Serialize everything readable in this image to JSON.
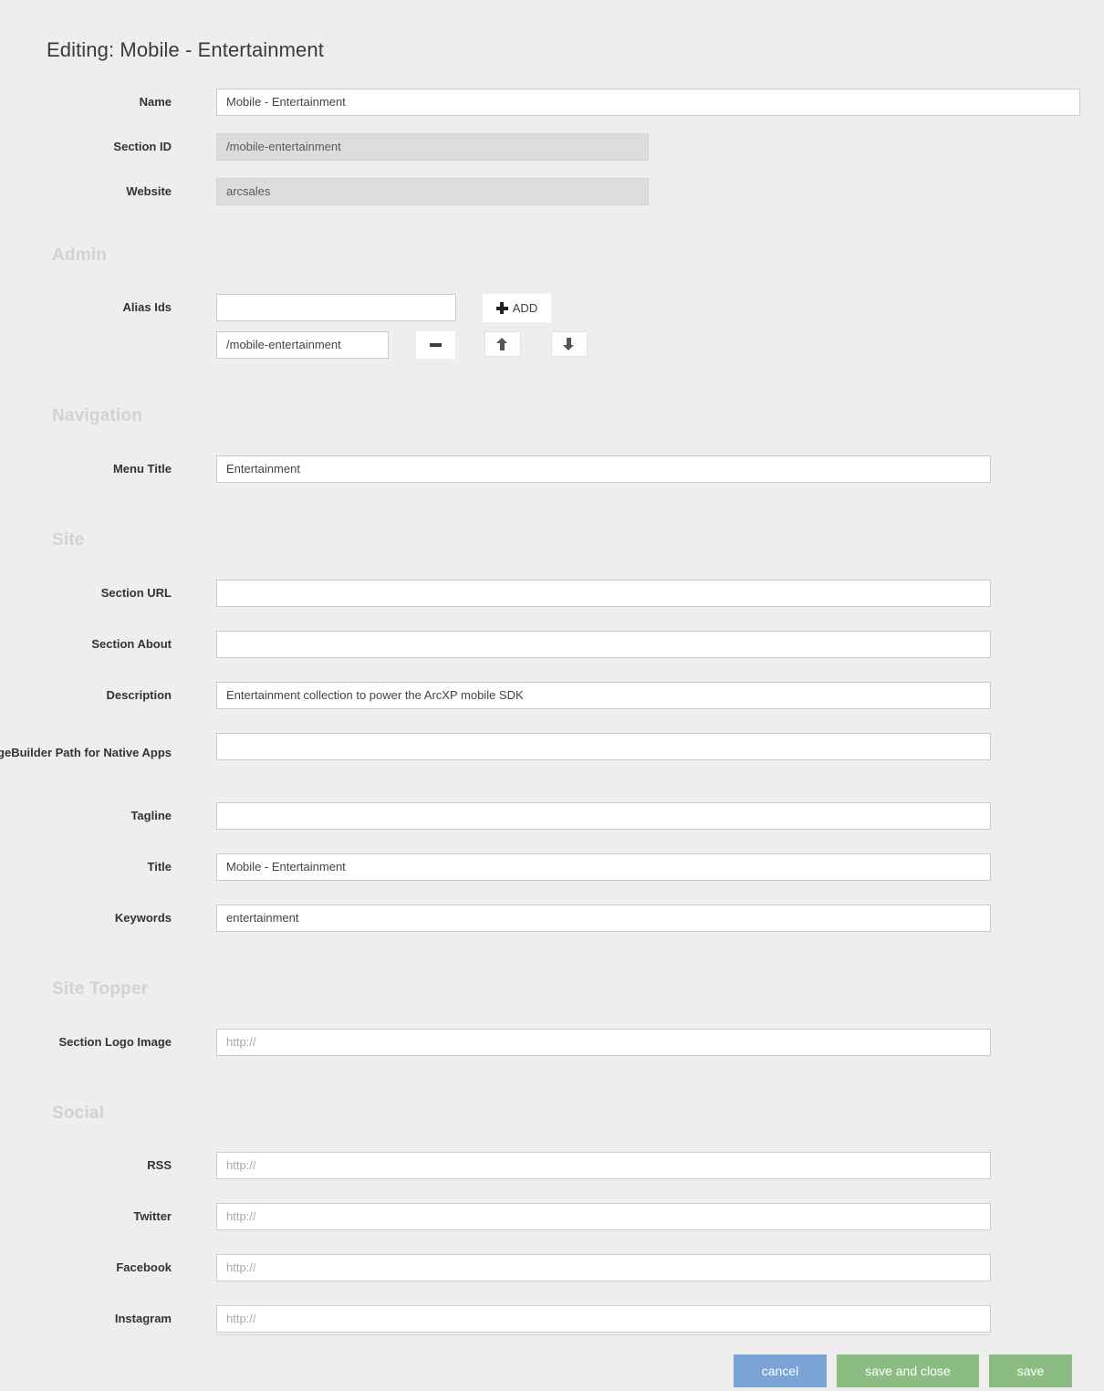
{
  "page": {
    "title": "Editing: Mobile - Entertainment"
  },
  "top_fields": [
    {
      "label": "Name",
      "value": "Mobile - Entertainment",
      "disabled": false
    },
    {
      "label": "Section ID",
      "value": "/mobile-entertainment",
      "disabled": true
    },
    {
      "label": "Website",
      "value": "arcsales",
      "disabled": true
    }
  ],
  "sections": {
    "admin": "Admin",
    "navigation": "Navigation",
    "site": "Site",
    "site_topper": "Site Topper",
    "social": "Social"
  },
  "alias": {
    "label": "Alias Ids",
    "new_value": "",
    "add_label": "ADD",
    "items": [
      {
        "value": "/mobile-entertainment"
      }
    ],
    "remove_label": "",
    "move_up_label": "",
    "move_down_label": ""
  },
  "navigation_fields": [
    {
      "label": "Menu Title",
      "value": "Entertainment",
      "placeholder": ""
    }
  ],
  "site_fields": [
    {
      "label": "Section URL",
      "value": "",
      "placeholder": ""
    },
    {
      "label": "Section About",
      "value": "",
      "placeholder": ""
    },
    {
      "label": "Description",
      "value": "Entertainment collection to power the ArcXP mobile SDK",
      "placeholder": ""
    },
    {
      "label": "PageBuilder Path for Native Apps",
      "value": "",
      "placeholder": ""
    },
    {
      "label": "Tagline",
      "value": "",
      "placeholder": ""
    },
    {
      "label": "Title",
      "value": "Mobile - Entertainment",
      "placeholder": ""
    },
    {
      "label": "Keywords",
      "value": "entertainment",
      "placeholder": ""
    }
  ],
  "site_topper_fields": [
    {
      "label": "Section Logo Image",
      "value": "",
      "placeholder": "http://"
    }
  ],
  "social_fields": [
    {
      "label": "RSS",
      "value": "",
      "placeholder": "http://"
    },
    {
      "label": "Twitter",
      "value": "",
      "placeholder": "http://"
    },
    {
      "label": "Facebook",
      "value": "",
      "placeholder": "http://"
    },
    {
      "label": "Instagram",
      "value": "",
      "placeholder": "http://"
    }
  ],
  "actions": {
    "cancel": "cancel",
    "save_and_close": "save and close",
    "save": "save"
  },
  "colors": {
    "background": "#eeeeee",
    "cancel_button": "#7ba3d6",
    "save_button": "#8bbd83",
    "section_heading": "#d2d2d2",
    "disabled_field": "#dcdcdc"
  }
}
